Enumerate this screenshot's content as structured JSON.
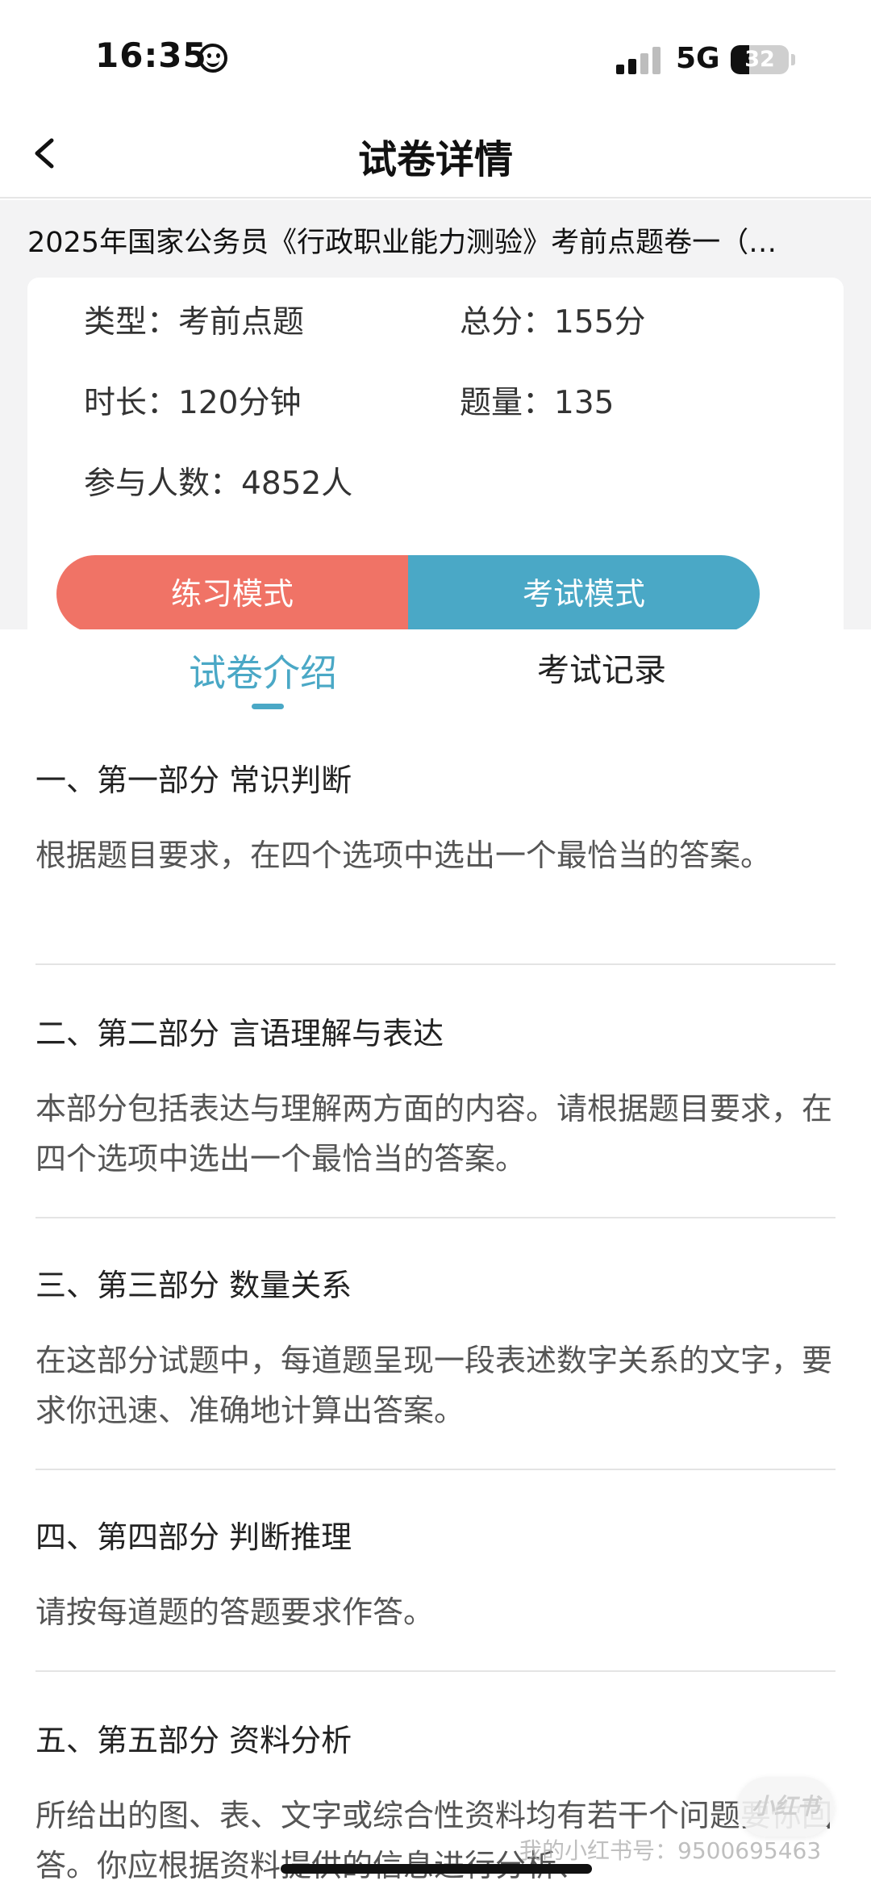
{
  "status_bar": {
    "time": "16:35",
    "network": "5G",
    "battery": "32"
  },
  "nav": {
    "title": "试卷详情"
  },
  "paper": {
    "title": "2025年国家公务员《行政职业能力测验》考前点题卷一（…",
    "info": {
      "type_label": "类型：",
      "type_value": "考前点题",
      "total_label": "总分：",
      "total_value": "155分",
      "duration_label": "时长：",
      "duration_value": "120分钟",
      "count_label": "题量：",
      "count_value": "135",
      "participants_label": "参与人数：",
      "participants_value": "4852人"
    },
    "modes": {
      "practice": "练习模式",
      "exam": "考试模式"
    }
  },
  "tabs": {
    "intro": "试卷介绍",
    "record": "考试记录",
    "active": "intro"
  },
  "sections": [
    {
      "title": "一、第一部分 常识判断",
      "desc": "根据题目要求，在四个选项中选出一个最恰当的答案。"
    },
    {
      "title": "二、第二部分 言语理解与表达",
      "desc": "本部分包括表达与理解两方面的内容。请根据题目要求，在四个选项中选出一个最恰当的答案。"
    },
    {
      "title": "三、第三部分 数量关系",
      "desc": "在这部分试题中，每道题呈现一段表述数字关系的文字，要求你迅速、准确地计算出答案。"
    },
    {
      "title": "四、第四部分 判断推理",
      "desc": "请按每道题的答题要求作答。"
    },
    {
      "title": "五、第五部分 资料分析",
      "desc": "所给出的图、表、文字或综合性资料均有若干个问题要你回答。你应根据资料提供的信息进行分析、"
    }
  ],
  "overlay": {
    "fab_label": "小红书",
    "watermark": "我的小红书号：9500695463"
  },
  "colors": {
    "practice": "#f07366",
    "exam": "#4aa8c6",
    "accent": "#4aa8c6"
  }
}
